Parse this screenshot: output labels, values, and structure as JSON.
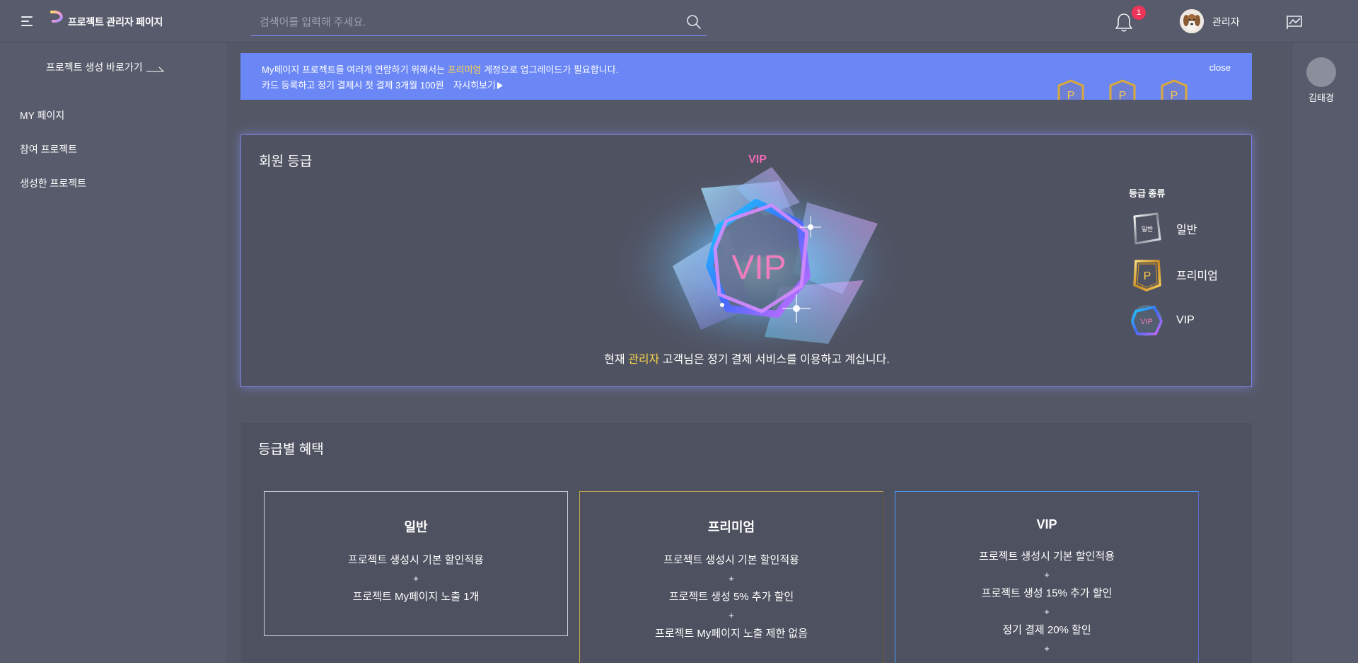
{
  "app": {
    "brand": "프로젝트 관리자 페이지",
    "logo_icon": "p-logo-icon",
    "menu_icon": "hamburger-icon"
  },
  "search": {
    "placeholder": "검색어를 입력해 주세요.",
    "value": ""
  },
  "header": {
    "notification_count": "1",
    "user_name": "관리자"
  },
  "sidebar": {
    "create_shortcut": "프로젝트 생성 바로가기",
    "items": [
      {
        "label": "MY 페이지"
      },
      {
        "label": "참여 프로젝트"
      },
      {
        "label": "생성한 프로젝트"
      }
    ]
  },
  "right_panel": {
    "user_name": "김태경"
  },
  "banner": {
    "line1_prefix": "My페이지 프로젝트를 여러개 연람하기 위해서는 ",
    "line1_highlight": "프리미엄",
    "line1_suffix": " 계정으로 업그레이드가 필요합니다.",
    "line2": "카드 등록하고 정기 결제시 첫 결제 3개월 100원",
    "more_label": "자시히보기",
    "close_label": "close",
    "badge_letter": "P"
  },
  "grade": {
    "title": "회원 등급",
    "current_grade": "VIP",
    "crystal_label": "VIP",
    "status_prefix": "현재 ",
    "status_name": "관리자",
    "status_suffix": " 고객님은 정기 결제 서비스를 이용하고 계십니다.",
    "legend_title": "등급 종류",
    "legend": [
      {
        "label": "일반",
        "badge_text": "일반"
      },
      {
        "label": "프리미엄",
        "badge_text": "P"
      },
      {
        "label": "VIP",
        "badge_text": "VIP"
      }
    ]
  },
  "benefits": {
    "title": "등급별 혜택",
    "tiers": [
      {
        "name": "일반",
        "lines": [
          "프로젝트 생성시 기본 할인적용",
          "+",
          "프로젝트 My페이지 노출 1개"
        ]
      },
      {
        "name": "프리미엄",
        "lines": [
          "프로젝트 생성시 기본 할인적용",
          "+",
          "프로젝트 생성 5% 추가 할인",
          "+",
          "프로젝트 My페이지 노출 제한 없음"
        ]
      },
      {
        "name": "VIP",
        "lines": [
          "프로젝트 생성시 기본 할인적용",
          "+",
          "프로젝트 생성 15% 추가 할인",
          "+",
          "정기 결제 20% 할인",
          "+"
        ]
      }
    ]
  },
  "colors": {
    "background": "#545866",
    "panel": "#575b6b",
    "banner": "#6b87f5",
    "highlight": "#ffd74a",
    "vip_pink": "#ef6bb8",
    "badge_red": "#ee3459"
  }
}
